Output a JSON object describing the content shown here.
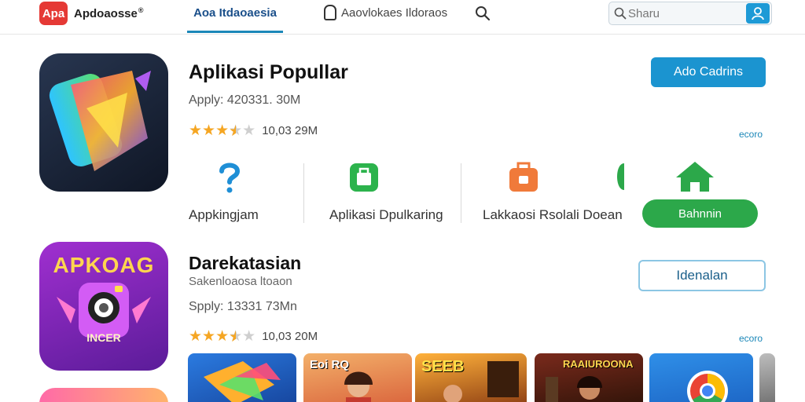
{
  "header": {
    "logo_text": "Apa",
    "brand": "Apdoaosse",
    "brand_mark": "®",
    "active_tab": "Aoa Itdaoaesia",
    "tab2": "Aaovlokaes Ildoraos",
    "search_placeholder": "Sharu",
    "icons": [
      "bag-icon",
      "search-icon",
      "user-icon"
    ]
  },
  "section1": {
    "title": "Aplikasi Popullar",
    "meta": "Apply: 420331. 30M",
    "stars_filled": 3.5,
    "rating_text": "10,03 29M",
    "primary_button": "Ado Cadrins",
    "more_link": "ecoro",
    "categories": [
      {
        "label": "Appkingjam",
        "icon": "question-icon",
        "color": "#1f8fd6"
      },
      {
        "label": "Aplikasi Dpulkaring",
        "icon": "shopping-bag-icon",
        "color": "#2cb34c"
      },
      {
        "label": "Lakkaosi Rsolali Doeanr",
        "icon": "briefcase-icon",
        "color": "#f07a3a"
      },
      {
        "label": "",
        "icon": "partial-green-icon",
        "color": "#2ca84a"
      },
      {
        "label": "",
        "icon": "house-icon",
        "color": "#2ca84a"
      }
    ],
    "green_button": "Bahnnin"
  },
  "section2": {
    "title": "Darekatasian",
    "subtitle": "Sakenloaosa ltoaon",
    "meta": "Spply: 13331 73Mn",
    "stars_filled": 3.5,
    "rating_text": "10,03 20M",
    "outline_button": "Idenalan",
    "more_link": "ecoro",
    "icon_text": "APKOAG",
    "icon_subtext": "INCER",
    "thumbnails": [
      "",
      "Eoi RQ",
      "SEEB",
      "RAAIUROONA",
      "",
      ""
    ]
  }
}
